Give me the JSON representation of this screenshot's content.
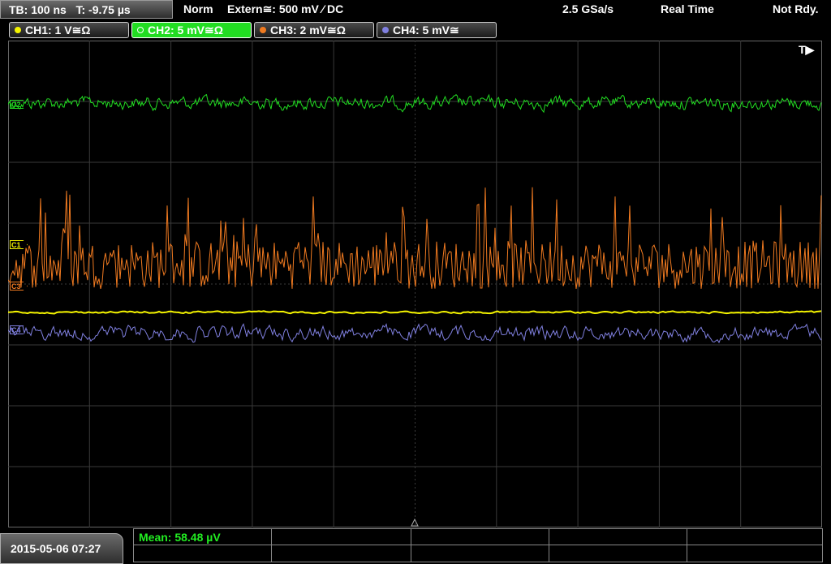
{
  "top_bar": {
    "timebase": "TB: 100 ns",
    "trigger_time": "T: -9.75 µs",
    "mode": "Norm",
    "trigger_source": "Extern≅: 500 mV ⁄ DC",
    "sample_rate": "2.5 GSa/s",
    "acquisition": "Real Time",
    "status": "Not Rdy."
  },
  "channels": [
    {
      "label": "CH1: 1 V≅Ω",
      "color": "#f5f500"
    },
    {
      "label": "CH2: 5 mV≅Ω",
      "color": "#22dd22"
    },
    {
      "label": "CH3: 2 mV≅Ω",
      "color": "#f07a20"
    },
    {
      "label": "CH4: 5 mV≅",
      "color": "#8080e0"
    }
  ],
  "markers": {
    "c1": "C1",
    "c2": "C2",
    "c3": "C3",
    "c4": "C4",
    "trigger": "T▶"
  },
  "waveforms": {
    "ch2_level": 0.128,
    "ch1_level": 0.558,
    "ch3_level": 0.48,
    "ch4_level": 0.6
  },
  "bottom": {
    "datetime": "2015-05-06 07:27",
    "measurement": "Mean: 58.48 µV"
  }
}
